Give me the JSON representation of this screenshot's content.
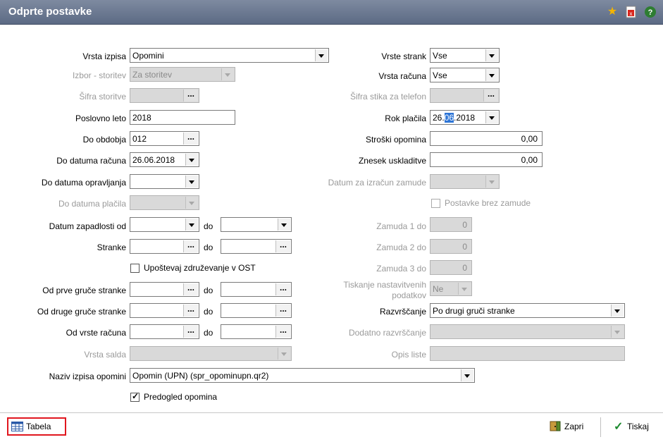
{
  "window": {
    "title": "Odprte postavke",
    "icons": [
      "star-icon",
      "pdf-icon",
      "help-icon"
    ]
  },
  "left": {
    "vrsta_izpisa": {
      "label": "Vrsta izpisa",
      "value": "Opomini"
    },
    "izbor_storitev": {
      "label": "Izbor - storitev",
      "value": "Za storitev"
    },
    "sifra_storitve": {
      "label": "Šifra storitve",
      "value": ""
    },
    "poslovno_leto": {
      "label": "Poslovno leto",
      "value": "2018"
    },
    "do_obdobja": {
      "label": "Do obdobja",
      "value": "012"
    },
    "do_datuma_racuna": {
      "label": "Do datuma računa",
      "value": "26.06.2018"
    },
    "do_datuma_opravljanja": {
      "label": "Do datuma opravljanja",
      "value": ""
    },
    "do_datuma_placila": {
      "label": "Do datuma plačila",
      "value": ""
    },
    "datum_zapadlosti": {
      "label": "Datum zapadlosti od",
      "do": "do"
    },
    "stranke": {
      "label": "Stranke",
      "do": "do"
    },
    "upostevaj": {
      "label": "Upoštevaj združevanje v OST",
      "checked": false
    },
    "od_prve_gruce": {
      "label": "Od prve gruče stranke",
      "do": "do"
    },
    "od_druge_gruce": {
      "label": "Od druge gruče stranke",
      "do": "do"
    },
    "od_vrste_racuna": {
      "label": "Od vrste računa",
      "do": "do"
    },
    "vrsta_salda": {
      "label": "Vrsta salda",
      "value": ""
    },
    "naziv_izpisa": {
      "label": "Naziv izpisa opomini",
      "value": "Opomin (UPN)  (spr_opominupn.qr2)"
    },
    "predogled": {
      "label": "Predogled opomina",
      "checked": true
    }
  },
  "right": {
    "vrste_strank": {
      "label": "Vrste strank",
      "value": "Vse"
    },
    "vrsta_racuna": {
      "label": "Vrsta računa",
      "value": "Vse"
    },
    "sifra_stika": {
      "label": "Šifra stika za telefon",
      "value": ""
    },
    "rok_placila": {
      "label": "Rok plačila",
      "value_pre": "26.",
      "value_sel": "06",
      "value_post": ".2018"
    },
    "stroski_opomina": {
      "label": "Stroški opomina",
      "value": "0,00"
    },
    "znesek_uskladitve": {
      "label": "Znesek uskladitve",
      "value": "0,00"
    },
    "datum_zamude": {
      "label": "Datum za izračun zamude",
      "value": ""
    },
    "postavke_brez": {
      "label": "Postavke brez zamude",
      "checked": false
    },
    "zamuda1": {
      "label": "Zamuda 1 do",
      "value": "0"
    },
    "zamuda2": {
      "label": "Zamuda 2 do",
      "value": "0"
    },
    "zamuda3": {
      "label": "Zamuda 3 do",
      "value": "0"
    },
    "tiskanje": {
      "label1": "Tiskanje nastavitvenih",
      "label2": "podatkov",
      "value": "Ne"
    },
    "razvrscanje": {
      "label": "Razvrščanje",
      "value": "Po drugi gruči stranke"
    },
    "dodatno": {
      "label": "Dodatno razvrščanje",
      "value": ""
    },
    "opis_liste": {
      "label": "Opis liste",
      "value": ""
    }
  },
  "bottom": {
    "tabela": "Tabela",
    "zapri": "Zapri",
    "tiskaj": "Tiskaj"
  }
}
